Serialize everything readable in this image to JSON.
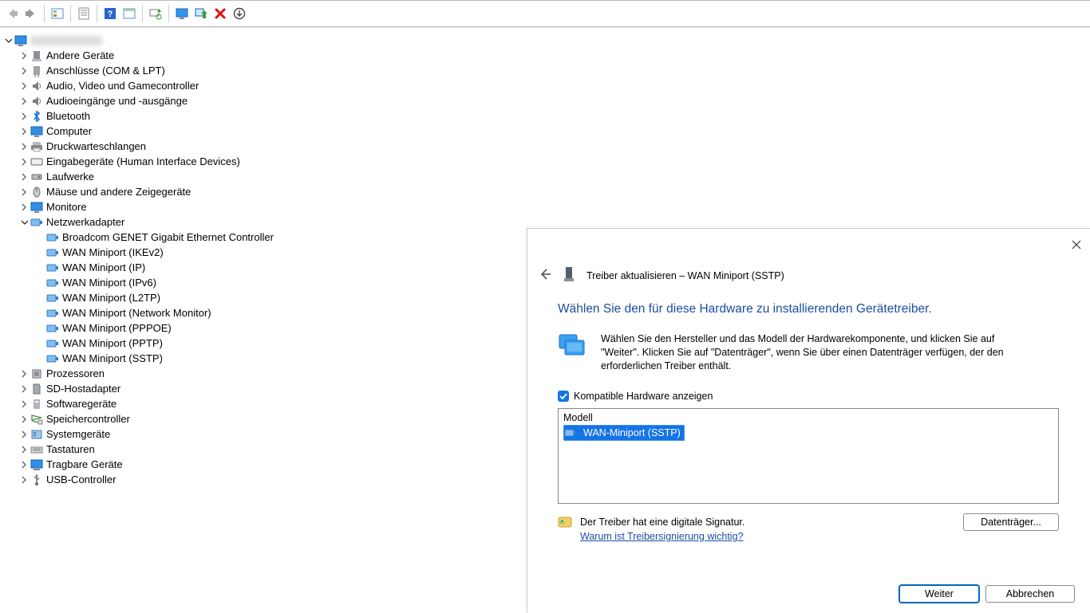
{
  "tree": {
    "root_label": "",
    "categories": [
      {
        "label": "Andere Geräte"
      },
      {
        "label": "Anschlüsse (COM & LPT)"
      },
      {
        "label": "Audio, Video und Gamecontroller"
      },
      {
        "label": "Audioeingänge und -ausgänge"
      },
      {
        "label": "Bluetooth"
      },
      {
        "label": "Computer"
      },
      {
        "label": "Druckwarteschlangen"
      },
      {
        "label": "Eingabegeräte (Human Interface Devices)"
      },
      {
        "label": "Laufwerke"
      },
      {
        "label": "Mäuse und andere Zeigegeräte"
      },
      {
        "label": "Monitore"
      },
      {
        "label": "Netzwerkadapter",
        "expanded": true,
        "children": [
          {
            "label": "Broadcom GENET Gigabit Ethernet Controller"
          },
          {
            "label": "WAN Miniport (IKEv2)"
          },
          {
            "label": "WAN Miniport (IP)"
          },
          {
            "label": "WAN Miniport (IPv6)"
          },
          {
            "label": "WAN Miniport (L2TP)"
          },
          {
            "label": "WAN Miniport (Network Monitor)"
          },
          {
            "label": "WAN Miniport (PPPOE)"
          },
          {
            "label": "WAN Miniport (PPTP)"
          },
          {
            "label": "WAN Miniport (SSTP)"
          }
        ]
      },
      {
        "label": "Prozessoren"
      },
      {
        "label": "SD-Hostadapter"
      },
      {
        "label": "Softwaregeräte"
      },
      {
        "label": "Speichercontroller"
      },
      {
        "label": "Systemgeräte"
      },
      {
        "label": "Tastaturen"
      },
      {
        "label": "Tragbare Geräte"
      },
      {
        "label": "USB-Controller"
      }
    ]
  },
  "dialog": {
    "title": "Treiber aktualisieren – WAN Miniport (SSTP)",
    "headline": "Wählen Sie den für diese Hardware zu installierenden Gerätetreiber.",
    "info": "Wählen Sie den Hersteller und das Modell der Hardwarekomponente, und klicken Sie auf \"Weiter\". Klicken Sie auf \"Datenträger\", wenn Sie über einen Datenträger verfügen, der den erforderlichen Treiber enthält.",
    "checkbox_label": "Kompatible Hardware anzeigen",
    "list_header": "Modell",
    "list_item": "WAN-Miniport (SSTP)",
    "signed_text": "Der Treiber hat eine digitale Signatur.",
    "signed_link": "Warum ist Treibersignierung wichtig?",
    "disk_button": "Datenträger...",
    "next_button": "Weiter",
    "cancel_button": "Abbrechen"
  }
}
